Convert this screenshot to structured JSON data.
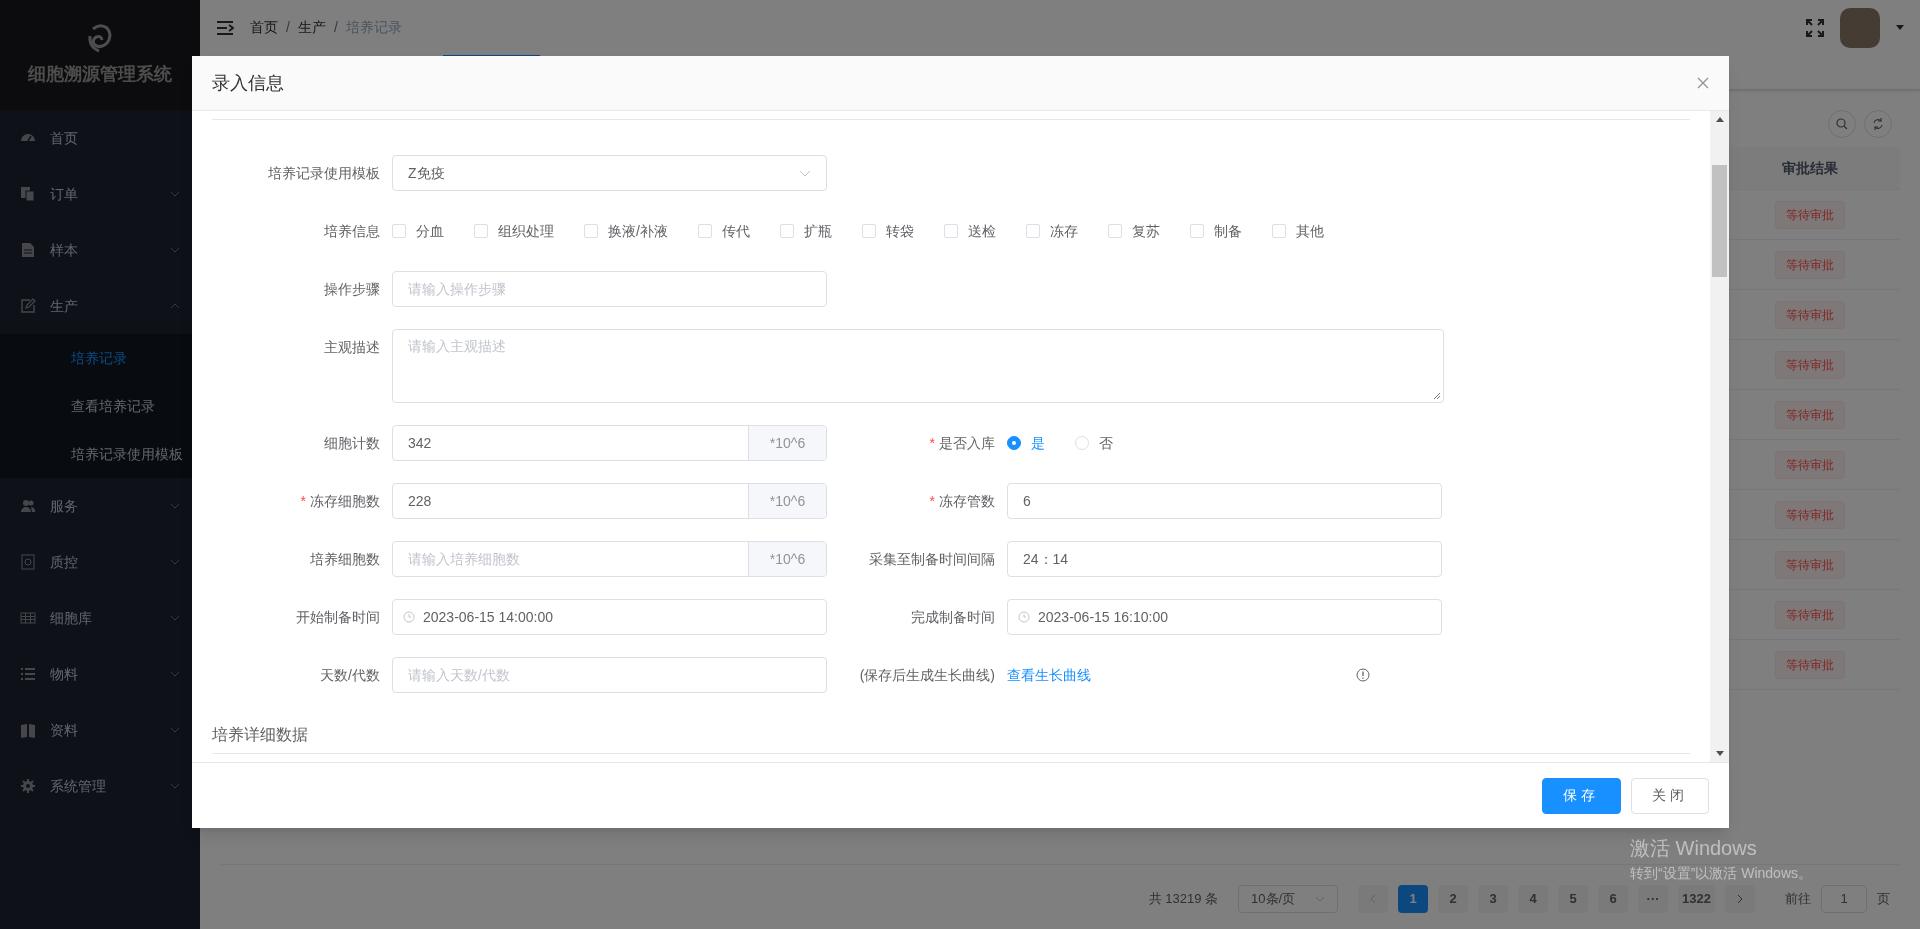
{
  "sidebar": {
    "title": "细胞溯源管理系统",
    "items": [
      {
        "label": "首页",
        "kind": "link"
      },
      {
        "label": "订单",
        "kind": "submenu",
        "expanded": false
      },
      {
        "label": "样本",
        "kind": "submenu",
        "expanded": false
      },
      {
        "label": "生产",
        "kind": "submenu",
        "expanded": true,
        "children": [
          {
            "label": "培养记录",
            "selected": true
          },
          {
            "label": "查看培养记录",
            "selected": false
          },
          {
            "label": "培养记录使用模板",
            "selected": false
          }
        ]
      },
      {
        "label": "服务",
        "kind": "submenu",
        "expanded": false
      },
      {
        "label": "质控",
        "kind": "submenu",
        "expanded": false
      },
      {
        "label": "细胞库",
        "kind": "submenu",
        "expanded": false
      },
      {
        "label": "物料",
        "kind": "submenu",
        "expanded": false
      },
      {
        "label": "资料",
        "kind": "submenu",
        "expanded": false
      },
      {
        "label": "系统管理",
        "kind": "submenu",
        "expanded": false
      }
    ]
  },
  "header": {
    "breadcrumb": [
      {
        "kind": "link",
        "text": "首页"
      },
      {
        "kind": "separator",
        "text": "/"
      },
      {
        "kind": "link",
        "text": "生产"
      },
      {
        "kind": "separator",
        "text": "/"
      },
      {
        "kind": "current",
        "text": "培养记录"
      }
    ]
  },
  "table": {
    "columns": [
      "审批结果"
    ],
    "rows": [
      {
        "status": "等待审批"
      },
      {
        "status": "等待审批"
      },
      {
        "status": "等待审批"
      },
      {
        "status": "等待审批"
      },
      {
        "status": "等待审批"
      },
      {
        "status": "等待审批"
      },
      {
        "status": "等待审批"
      },
      {
        "status": "等待审批"
      },
      {
        "status": "等待审批"
      },
      {
        "status": "等待审批"
      }
    ]
  },
  "pagination": {
    "total": "共 13219 条",
    "page_size": "10条/页",
    "pages": [
      {
        "label": "1",
        "selected": true
      },
      {
        "label": "2",
        "selected": false
      },
      {
        "label": "3",
        "selected": false
      },
      {
        "label": "4",
        "selected": false
      },
      {
        "label": "5",
        "selected": false
      },
      {
        "label": "6",
        "selected": false
      },
      {
        "label": "···",
        "selected": false
      },
      {
        "label": "1322",
        "selected": false
      }
    ],
    "goto_label": "前往",
    "goto_value": "1",
    "goto_suffix": "页"
  },
  "dialog": {
    "title": "录入信息",
    "rows": [
      {
        "fields": [
          {
            "kind": "select",
            "label": "培养记录使用模板",
            "value": "Z免疫"
          }
        ]
      },
      {
        "fields": [
          {
            "kind": "checkboxes",
            "label": "培养信息",
            "options": [
              {
                "label": "分血",
                "checked": false
              },
              {
                "label": "组织处理",
                "checked": false
              },
              {
                "label": "换液/补液",
                "checked": false
              },
              {
                "label": "传代",
                "checked": false
              },
              {
                "label": "扩瓶",
                "checked": false
              },
              {
                "label": "转袋",
                "checked": false
              },
              {
                "label": "送检",
                "checked": false
              },
              {
                "label": "冻存",
                "checked": false
              },
              {
                "label": "复苏",
                "checked": false
              },
              {
                "label": "制备",
                "checked": false
              },
              {
                "label": "其他",
                "checked": false
              }
            ]
          }
        ]
      },
      {
        "fields": [
          {
            "kind": "input",
            "label": "操作步骤",
            "placeholder": "请输入操作步骤"
          }
        ]
      },
      {
        "fields": [
          {
            "kind": "textarea",
            "label": "主观描述",
            "placeholder": "请输入主观描述"
          }
        ]
      },
      {
        "fields": [
          {
            "kind": "input_unit",
            "label": "细胞计数",
            "value": "342",
            "unit": "*10^6"
          },
          {
            "kind": "radio",
            "label": "是否入库",
            "required_mark": "*",
            "options": [
              {
                "label": "是",
                "selected": true
              },
              {
                "label": "否",
                "selected": false
              }
            ]
          }
        ]
      },
      {
        "fields": [
          {
            "kind": "input_unit",
            "label": "冻存细胞数",
            "required_mark": "*",
            "value": "228",
            "unit": "*10^6"
          },
          {
            "kind": "input",
            "label": "冻存管数",
            "required_mark": "*",
            "value": "6"
          }
        ]
      },
      {
        "fields": [
          {
            "kind": "input_unit",
            "label": "培养细胞数",
            "placeholder": "请输入培养细胞数",
            "unit": "*10^6"
          },
          {
            "kind": "input",
            "label": "采集至制备时间间隔",
            "value": "24：14"
          }
        ]
      },
      {
        "fields": [
          {
            "kind": "datetime",
            "label": "开始制备时间",
            "value": "2023-06-15 14:00:00"
          },
          {
            "kind": "datetime",
            "label": "完成制备时间",
            "value": "2023-06-15 16:10:00"
          }
        ]
      },
      {
        "fields": [
          {
            "kind": "input",
            "label": "天数/代数",
            "placeholder": "请输入天数/代数"
          },
          {
            "kind": "note",
            "label": "(保存后生成生长曲线)",
            "link": "查看生长曲线"
          }
        ]
      }
    ],
    "section_title": "培养详细数据",
    "buttons": [
      {
        "label": "保存",
        "kind": "primary"
      },
      {
        "label": "关闭",
        "kind": "default"
      }
    ]
  },
  "os_watermark": {
    "title": "激活 Windows",
    "subtitle": "转到“设置”以激活 Windows。"
  }
}
